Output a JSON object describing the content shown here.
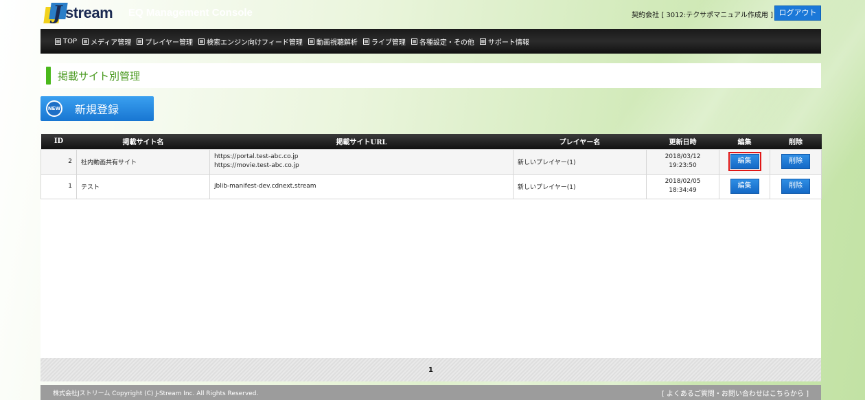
{
  "header": {
    "logo_text": "stream",
    "logo_letter": "J",
    "console_title": "EQ Management Console",
    "account_text": "契約会社 [ 3012:テクサポマニュアル作成用 ]",
    "logout_label": "ログアウト"
  },
  "nav": {
    "items": [
      {
        "label": "TOP"
      },
      {
        "label": "メディア管理"
      },
      {
        "label": "プレイヤー管理"
      },
      {
        "label": "検索エンジン向けフィード管理"
      },
      {
        "label": "動画視聴解析"
      },
      {
        "label": "ライブ管理"
      },
      {
        "label": "各種設定・その他"
      },
      {
        "label": "サポート情報"
      }
    ]
  },
  "page": {
    "title": "掲載サイト別管理",
    "new_badge": "NEW",
    "new_button": "新規登録"
  },
  "table": {
    "headers": {
      "id": "ID",
      "site_name": "掲載サイト名",
      "site_url": "掲載サイトURL",
      "player_name": "プレイヤー名",
      "updated": "更新日時",
      "edit": "編集",
      "delete": "削除"
    },
    "rows": [
      {
        "id": "2",
        "site_name": "社内動画共有サイト",
        "url1": "https://portal.test-abc.co.jp",
        "url2": "https://movie.test-abc.co.jp",
        "player": "新しいプレイヤー(1)",
        "date": "2018/03/12",
        "time": "19:23:50",
        "edit": "編集",
        "delete": "削除"
      },
      {
        "id": "1",
        "site_name": "テスト",
        "url1": "jblib-manifest-dev.cdnext.stream",
        "url2": "",
        "player": "新しいプレイヤー(1)",
        "date": "2018/02/05",
        "time": "18:34:49",
        "edit": "編集",
        "delete": "削除"
      }
    ]
  },
  "pager": {
    "current": "1"
  },
  "footer": {
    "copyright": "株式会社Jストリーム Copyright (C) J-Stream Inc. All Rights Reserved.",
    "help": "[ よくあるご質問・お問い合わせはこちらから ]"
  },
  "colors": {
    "accent_blue": "#1b78d8",
    "brand_green": "#4ab81c",
    "highlight_red": "#e01616"
  }
}
